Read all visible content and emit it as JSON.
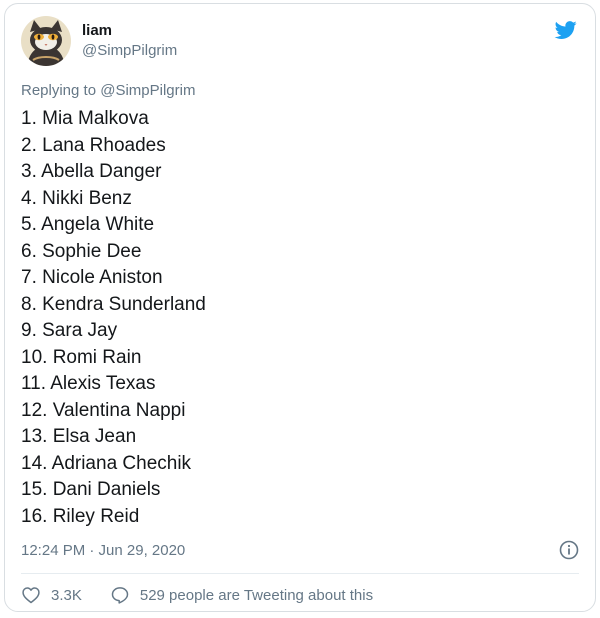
{
  "tweet": {
    "display_name": "liam",
    "handle": "@SimpPilgrim",
    "replying_prefix": "Replying to",
    "replying_handle": "@SimpPilgrim",
    "lines": [
      "1. Mia Malkova",
      "2. Lana Rhoades",
      "3. Abella Danger",
      "4. Nikki Benz",
      "5. Angela White",
      "6. Sophie Dee",
      "7. Nicole Aniston",
      "8. Kendra Sunderland",
      "9. Sara Jay",
      "10. Romi Rain",
      "11. Alexis Texas",
      "12. Valentina Nappi",
      "13. Elsa Jean",
      "14. Adriana Chechik",
      "15. Dani Daniels",
      "16. Riley Reid"
    ],
    "timestamp": "12:24 PM · Jun 29, 2020"
  },
  "actions": {
    "like_count": "3.3K",
    "tweeting_about": "529 people are Tweeting about this"
  },
  "icons": {
    "brand": "twitter-bird-icon",
    "info": "info-icon",
    "like": "heart-icon",
    "reply": "speech-bubble-icon"
  },
  "colors": {
    "brand_blue": "#1da1f2",
    "secondary_text": "#657786",
    "primary_text": "#14171a",
    "border": "#d9dee2"
  }
}
